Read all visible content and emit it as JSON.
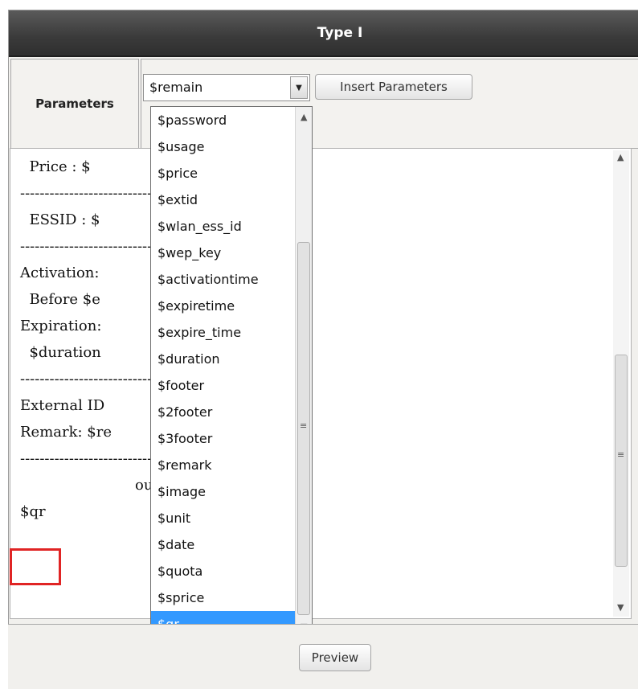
{
  "panel": {
    "title": "Type I"
  },
  "parameters": {
    "label": "Parameters",
    "selected_value": "$remain",
    "insert_button_label": "Insert Parameters"
  },
  "dropdown": {
    "options": [
      "$password",
      "$usage",
      "$price",
      "$extid",
      "$wlan_ess_id",
      "$wep_key",
      "$activationtime",
      "$expiretime",
      "$expire_time",
      "$duration",
      "$footer",
      "$2footer",
      "$3footer",
      "$remark",
      "$image",
      "$unit",
      "$date",
      "$quota",
      "$sprice",
      "$qr"
    ],
    "highlighted": "$qr"
  },
  "editor": {
    "lines": [
      "  Price : $",
      "-------------------------------------------------",
      "  ESSID : $",
      "-------------------------------------------------",
      "Activation:",
      "  Before $e",
      "Expiration:",
      "  $duration              vation",
      "-------------------------------------------------",
      "External ID",
      "Remark: $re",
      "-------------------------------------------------",
      "                         ou",
      "",
      "$qr"
    ]
  },
  "footer": {
    "preview_button_label": "Preview"
  },
  "colors": {
    "highlight": "#3399ff",
    "marker": "#e02424",
    "title_bar": "#3a3a3a"
  }
}
